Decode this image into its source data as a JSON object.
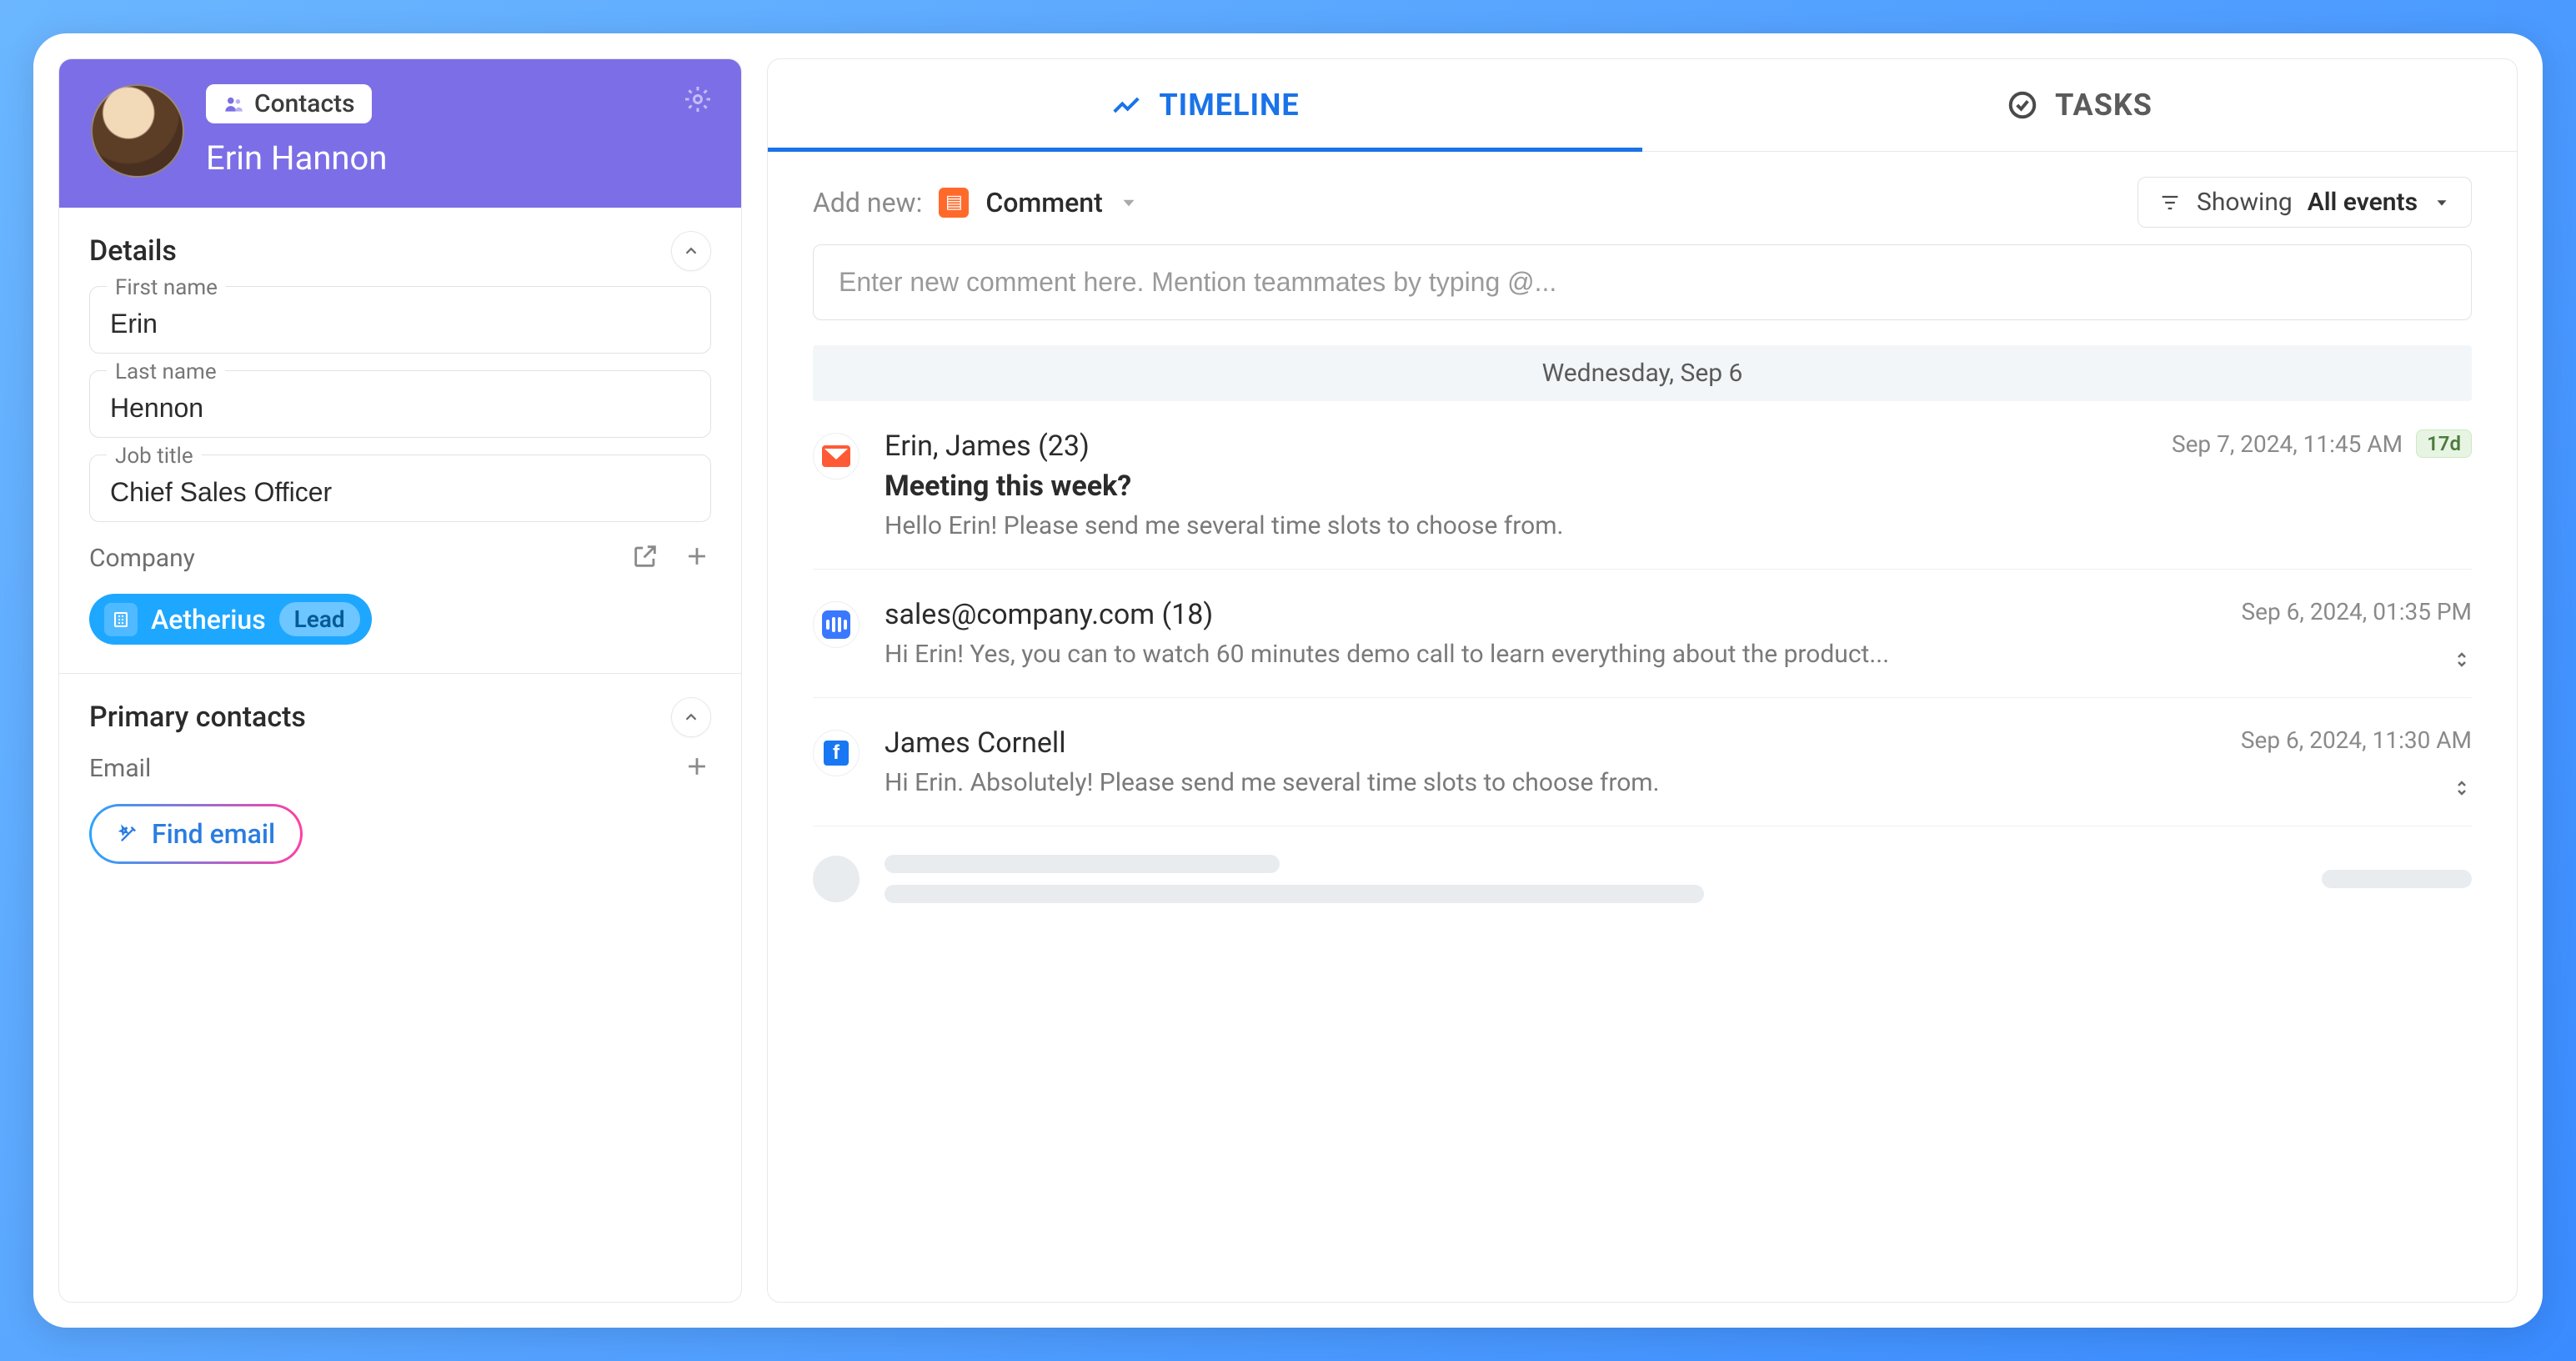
{
  "sidebar": {
    "chip_label": "Contacts",
    "contact_name": "Erin Hannon",
    "details": {
      "title": "Details",
      "first_name_label": "First name",
      "first_name_value": "Erin",
      "last_name_label": "Last name",
      "last_name_value": "Hennon",
      "job_title_label": "Job title",
      "job_title_value": "Chief Sales Officer",
      "company_label": "Company",
      "company_name": "Aetherius",
      "company_stage": "Lead"
    },
    "primary_contacts": {
      "title": "Primary contacts",
      "email_label": "Email",
      "find_email_label": "Find email"
    }
  },
  "tabs": {
    "timeline": "TIMELINE",
    "tasks": "TASKS"
  },
  "toolbar": {
    "add_new_label": "Add new:",
    "add_new_type": "Comment",
    "filter_prefix": "Showing",
    "filter_value": "All events"
  },
  "comment_placeholder": "Enter new comment here. Mention teammates by typing @...",
  "date_separator": "Wednesday, Sep 6",
  "events": [
    {
      "from": "Erin, James (23)",
      "timestamp": "Sep 7, 2024, 11:45 AM",
      "age": "17d",
      "subject": "Meeting this week?",
      "preview": "Hello Erin! Please send me several time slots to choose from."
    },
    {
      "from": "sales@company.com (18)",
      "timestamp": "Sep 6, 2024, 01:35 PM",
      "preview": "Hi Erin! Yes, you can to watch 60 minutes demo call to learn everything about the product..."
    },
    {
      "from": "James Cornell",
      "timestamp": "Sep 6, 2024, 11:30 AM",
      "preview": "Hi Erin. Absolutely! Please send me several time slots to choose from."
    }
  ]
}
